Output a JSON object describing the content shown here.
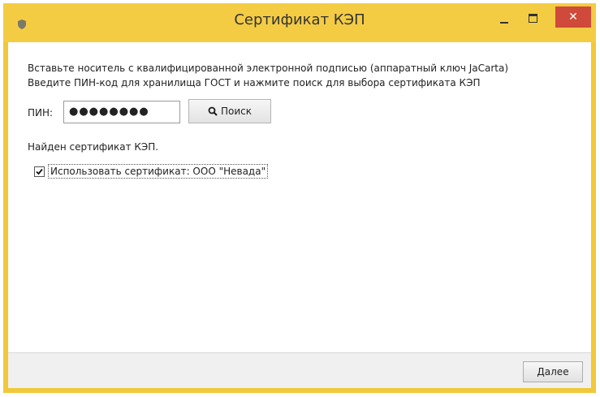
{
  "window": {
    "title": "Сертификат КЭП",
    "close_glyph": "✕"
  },
  "instructions": {
    "line1": "Вставьте носитель с квалифицированной электронной подписью (аппаратный ключ JaCarta)",
    "line2": "Введите ПИН-код для хранилища ГОСТ и нажмите поиск для выбора сертификата КЭП"
  },
  "pin": {
    "label": "ПИН:",
    "value": "●●●●●●●●"
  },
  "search_button": {
    "label": "Поиск",
    "icon": "search-icon"
  },
  "status": {
    "found_text": "Найден сертификат КЭП."
  },
  "certificate": {
    "checked": true,
    "label": "Использовать сертификат: ООО \"Невада\""
  },
  "footer": {
    "next_label": "Далее"
  },
  "colors": {
    "titlebar": "#f4cc44",
    "close_button": "#cf4a3a"
  }
}
